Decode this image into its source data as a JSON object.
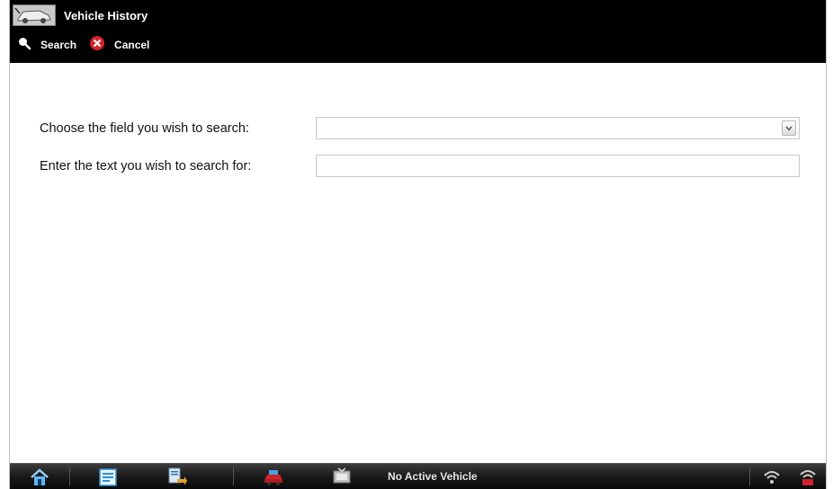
{
  "header": {
    "title": "Vehicle History",
    "app_icon": "vehicle-history-icon"
  },
  "toolbar": {
    "search_label": "Search",
    "search_icon": "magnifier-icon",
    "cancel_label": "Cancel",
    "cancel_icon": "cancel-x-icon",
    "cancel_color": "#d2232a"
  },
  "form": {
    "field_label": "Choose the field you wish to search:",
    "field_value": "",
    "text_label": "Enter the text you wish to search for:",
    "text_value": "",
    "text_placeholder": ""
  },
  "taskbar": {
    "icons": [
      "home-icon",
      "shop-manager-icon",
      "data-manager-icon",
      "vehicle-select-icon",
      "scanner-icon"
    ],
    "status_text": "No Active Vehicle",
    "right_icons": [
      "wireless-icon",
      "connection-status-icon"
    ],
    "accent_color": "#d2232a"
  }
}
